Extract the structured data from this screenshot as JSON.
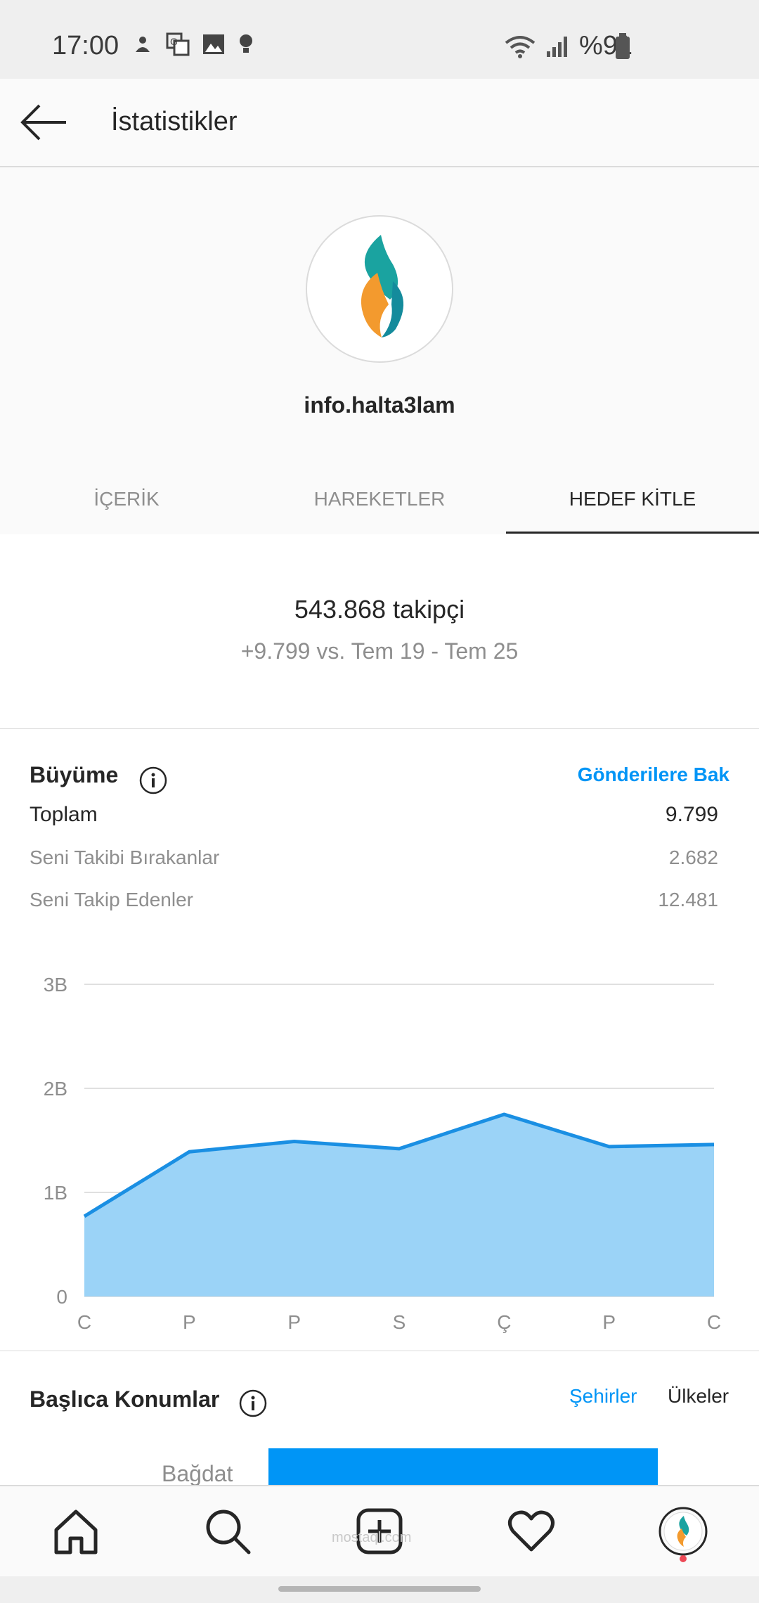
{
  "status_bar": {
    "time": "17:00",
    "battery": "%91",
    "icons": [
      "notification-icon",
      "translate-icon",
      "image-icon",
      "bulb-icon",
      "wifi-icon",
      "signal-icon",
      "battery-icon"
    ]
  },
  "header": {
    "title": "İstatistikler"
  },
  "profile": {
    "username": "info.halta3lam"
  },
  "tabs": [
    {
      "label": "İÇERİK"
    },
    {
      "label": "HAREKETLER"
    },
    {
      "label": "HEDEF KİTLE"
    }
  ],
  "followers": {
    "count": "543.868 takipçi",
    "delta": "+9.799 vs. Tem 19 - Tem 25"
  },
  "growth": {
    "title": "Büyüme",
    "link": "Gönderilere Bak",
    "rows": [
      {
        "label": "Toplam",
        "value": "9.799"
      },
      {
        "label": "Seni Takibi Bırakanlar",
        "value": "2.682"
      },
      {
        "label": "Seni Takip Edenler",
        "value": "12.481"
      }
    ]
  },
  "chart_data": {
    "type": "area",
    "categories": [
      "C",
      "P",
      "P",
      "S",
      "Ç",
      "P",
      "C"
    ],
    "yticks": [
      "0",
      "1B",
      "2B",
      "3B"
    ],
    "values": [
      770,
      1390,
      1490,
      1420,
      1750,
      1440,
      1460
    ],
    "ylim": [
      0,
      3000
    ],
    "grid": true,
    "colors": {
      "line": "#1a8fe3",
      "fill": "#9bd3f7"
    }
  },
  "locations": {
    "title": "Başlıca Konumlar",
    "tab_active": "Şehirler",
    "tab_other": "Ülkeler",
    "bar_label": "Bağdat"
  },
  "bottom_nav": {
    "items": [
      "home-icon",
      "search-icon",
      "add-post-icon",
      "activity-heart-icon",
      "profile-avatar-icon"
    ],
    "watermark": "mostaql.com"
  }
}
